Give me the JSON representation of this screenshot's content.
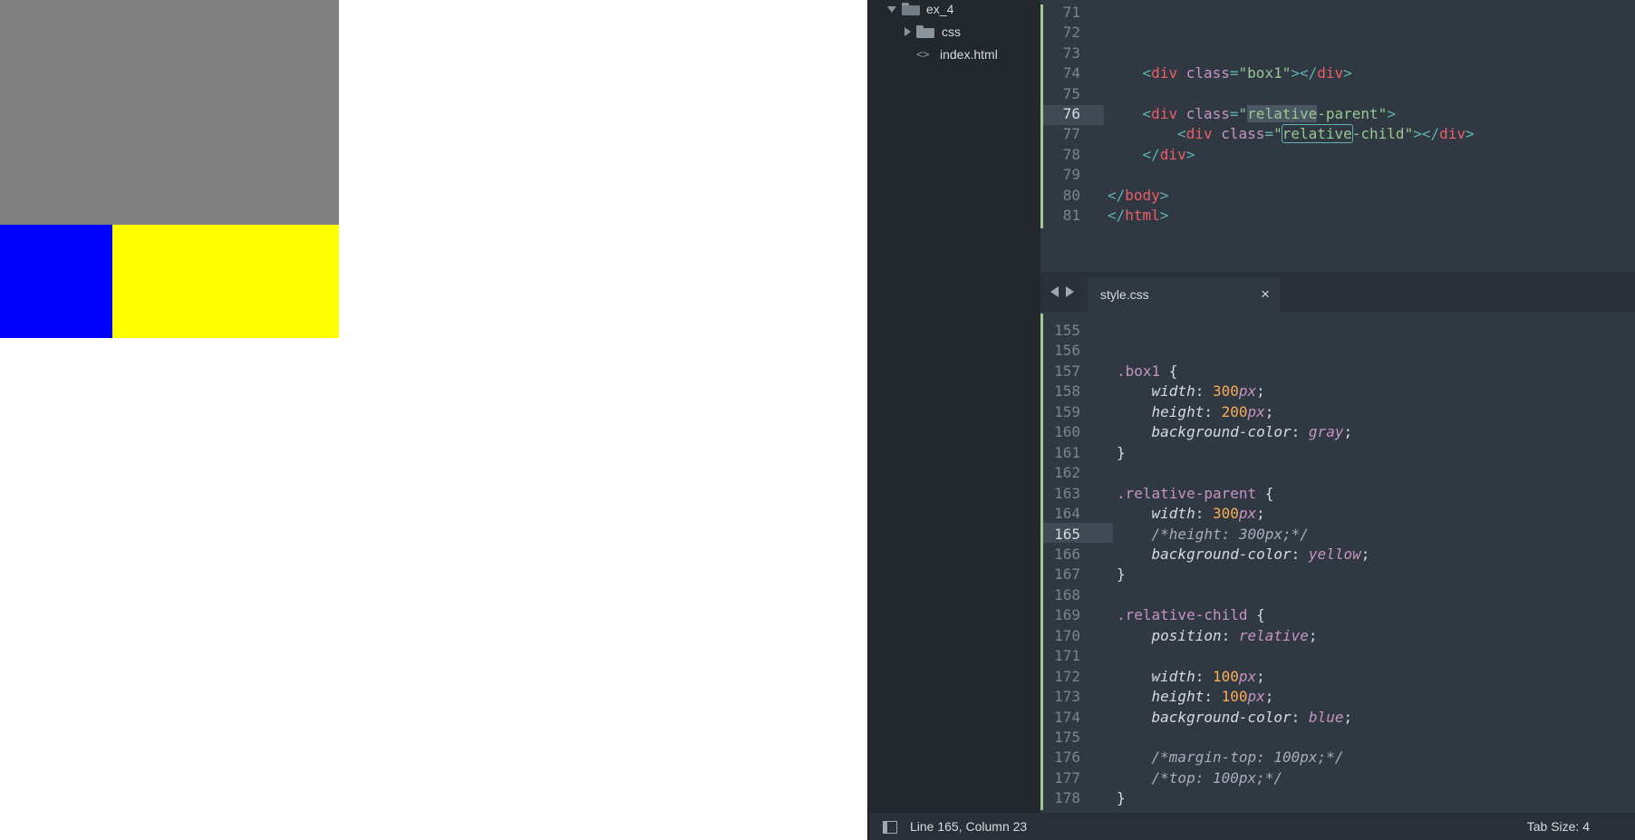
{
  "sidebar": {
    "root_folder": "ex_4",
    "items": [
      {
        "label": "css",
        "type": "folder"
      },
      {
        "label": "index.html",
        "type": "file"
      }
    ]
  },
  "html_pane": {
    "active_line": "76",
    "lines": [
      {
        "n": "71"
      },
      {
        "n": "72"
      },
      {
        "n": "73"
      },
      {
        "n": "74",
        "indent": "    ",
        "open": "<",
        "tag": "div",
        "attr": "class",
        "eq": "=",
        "q1": "\"",
        "val": "box1",
        "q2": "\"",
        "close": "></",
        "tag2": "div",
        "end": ">"
      },
      {
        "n": "75"
      },
      {
        "n": "76",
        "indent": "    ",
        "open": "<",
        "tag": "div",
        "attr": "class",
        "eq": "=",
        "q1": "\"",
        "val_a": "relative",
        "val_b": "-parent",
        "q2": "\"",
        "end": ">"
      },
      {
        "n": "77",
        "indent": "        ",
        "open": "<",
        "tag": "div",
        "attr": "class",
        "eq": "=",
        "q1": "\"",
        "val_a": "relative",
        "val_b": "-child",
        "q2": "\"",
        "close": "></",
        "tag2": "div",
        "end": ">"
      },
      {
        "n": "78",
        "indent": "    ",
        "open": "</",
        "tag": "div",
        "end": ">"
      },
      {
        "n": "79"
      },
      {
        "n": "80",
        "open": "</",
        "tag": "body",
        "end": ">"
      },
      {
        "n": "81",
        "open": "</",
        "tag": "html",
        "end": ">"
      }
    ]
  },
  "tab": {
    "label": "style.css",
    "close": "×"
  },
  "css_pane": {
    "active_line": "165",
    "lines": [
      {
        "n": "155"
      },
      {
        "n": "156"
      },
      {
        "n": "157",
        "selector": ".box1",
        "brace": " {"
      },
      {
        "n": "158",
        "prop": "width",
        "num": "300",
        "unit": "px"
      },
      {
        "n": "159",
        "prop": "height",
        "num": "200",
        "unit": "px"
      },
      {
        "n": "160",
        "prop": "background-color",
        "kw": "gray"
      },
      {
        "n": "161",
        "brace": "}"
      },
      {
        "n": "162"
      },
      {
        "n": "163",
        "selector": ".relative-parent",
        "brace": " {"
      },
      {
        "n": "164",
        "prop": "width",
        "num": "300",
        "unit": "px"
      },
      {
        "n": "165",
        "comment": "/*height: 300px;*/"
      },
      {
        "n": "166",
        "prop": "background-color",
        "kw": "yellow"
      },
      {
        "n": "167",
        "brace": "}"
      },
      {
        "n": "168"
      },
      {
        "n": "169",
        "selector": ".relative-child",
        "brace": " {"
      },
      {
        "n": "170",
        "prop": "position",
        "kw": "relative"
      },
      {
        "n": "171"
      },
      {
        "n": "172",
        "prop": "width",
        "num": "100",
        "unit": "px"
      },
      {
        "n": "173",
        "prop": "height",
        "num": "100",
        "unit": "px"
      },
      {
        "n": "174",
        "prop": "background-color",
        "kw": "blue"
      },
      {
        "n": "175"
      },
      {
        "n": "176",
        "comment": "/*margin-top: 100px;*/"
      },
      {
        "n": "177",
        "comment": "/*top: 100px;*/"
      },
      {
        "n": "178",
        "brace": "}"
      }
    ]
  },
  "statusbar": {
    "position": "Line 165, Column 23",
    "tab_size": "Tab Size: 4"
  },
  "colors": {
    "box1": "#808080",
    "parent": "#ffff00",
    "child": "#0000ff",
    "editor_bg": "#303841",
    "sidebar_bg": "#23282d"
  }
}
